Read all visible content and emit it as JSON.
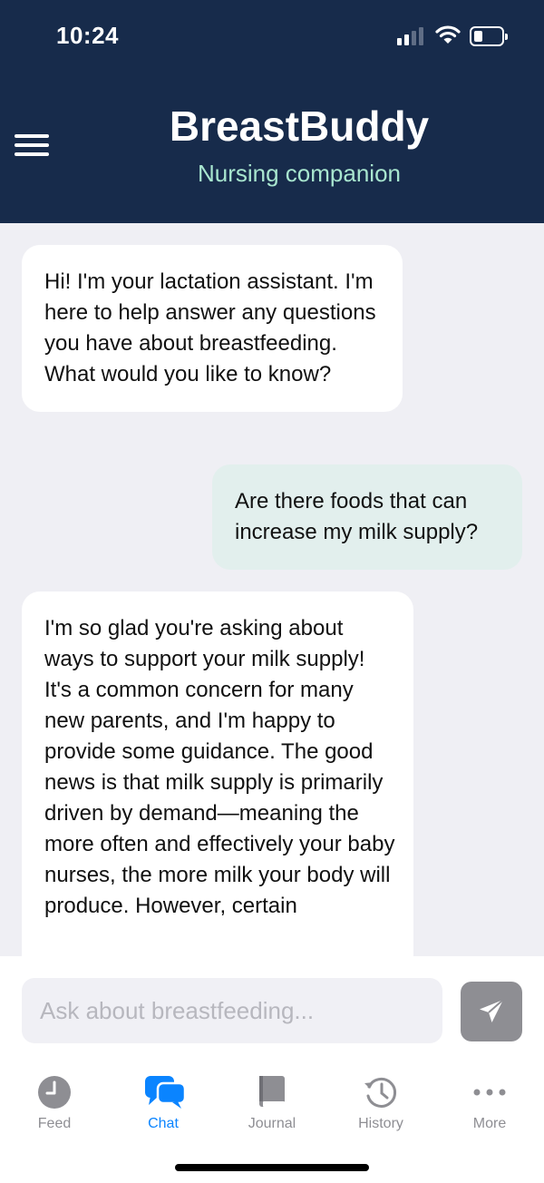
{
  "status_bar": {
    "time": "10:24"
  },
  "header": {
    "title": "BreastBuddy",
    "subtitle": "Nursing companion",
    "menu_icon": "hamburger-menu-icon"
  },
  "messages": [
    {
      "role": "assistant",
      "text": "Hi! I'm your lactation assistant. I'm here to help answer any questions you have about breastfeeding. What would you like to know?"
    },
    {
      "role": "user",
      "text": "Are there foods that can increase my milk supply?"
    },
    {
      "role": "assistant",
      "text": "I'm so glad you're asking about ways to support your milk supply! It's a common concern for many new parents, and I'm happy to provide some guidance. The good news is that milk supply is primarily driven by demand—meaning the more often and effectively your baby nurses, the more milk your body will produce. However, certain"
    }
  ],
  "composer": {
    "placeholder": "Ask about breastfeeding...",
    "send_icon": "paper-plane-icon"
  },
  "tabs": [
    {
      "label": "Feed",
      "icon": "clock-icon",
      "active": false
    },
    {
      "label": "Chat",
      "icon": "chat-bubbles-icon",
      "active": true
    },
    {
      "label": "Journal",
      "icon": "book-icon",
      "active": false
    },
    {
      "label": "History",
      "icon": "history-icon",
      "active": false
    },
    {
      "label": "More",
      "icon": "ellipsis-icon",
      "active": false
    }
  ],
  "colors": {
    "header_bg": "#172b4b",
    "subtitle": "#a8e6cf",
    "user_bubble": "#e2efed",
    "accent": "#0a84ff",
    "inactive": "#8e8e93"
  }
}
